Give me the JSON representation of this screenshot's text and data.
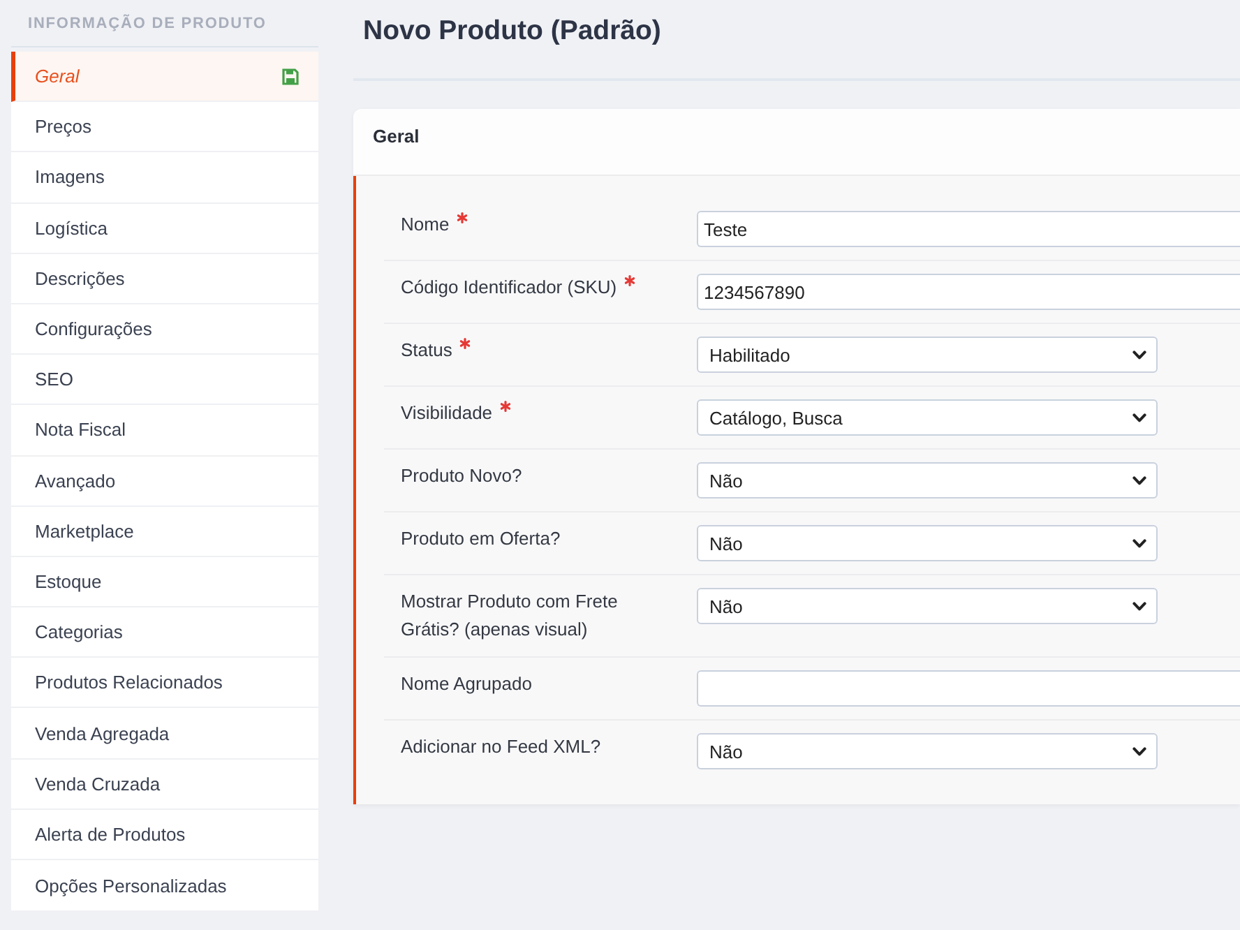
{
  "sidebar": {
    "heading": "INFORMAÇÃO DE PRODUTO",
    "items": [
      {
        "label": "Geral",
        "selected": true
      },
      {
        "label": "Preços",
        "selected": false
      },
      {
        "label": "Imagens",
        "selected": false
      },
      {
        "label": "Logística",
        "selected": false
      },
      {
        "label": "Descrições",
        "selected": false
      },
      {
        "label": "Configurações",
        "selected": false
      },
      {
        "label": "SEO",
        "selected": false
      },
      {
        "label": "Nota Fiscal",
        "selected": false
      },
      {
        "label": "Avançado",
        "selected": false
      },
      {
        "label": "Marketplace",
        "selected": false
      },
      {
        "label": "Estoque",
        "selected": false
      },
      {
        "label": "Categorias",
        "selected": false
      },
      {
        "label": "Produtos Relacionados",
        "selected": false
      },
      {
        "label": "Venda Agregada",
        "selected": false
      },
      {
        "label": "Venda Cruzada",
        "selected": false
      },
      {
        "label": "Alerta de Produtos",
        "selected": false
      },
      {
        "label": "Opções Personalizadas",
        "selected": false
      }
    ]
  },
  "page": {
    "title": "Novo Produto (Padrão)"
  },
  "card": {
    "title": "Geral",
    "fields": [
      {
        "kind": "text",
        "label": "Nome",
        "required": true,
        "value": "Teste"
      },
      {
        "kind": "text",
        "label": "Código Identificador (SKU)",
        "required": true,
        "value": "1234567890"
      },
      {
        "kind": "select",
        "label": "Status",
        "required": true,
        "value": "Habilitado"
      },
      {
        "kind": "select",
        "label": "Visibilidade",
        "required": true,
        "value": "Catálogo, Busca"
      },
      {
        "kind": "select",
        "label": "Produto Novo?",
        "required": false,
        "value": "Não"
      },
      {
        "kind": "select",
        "label": "Produto em Oferta?",
        "required": false,
        "value": "Não"
      },
      {
        "kind": "select",
        "label": "Mostrar Produto com Frete Grátis? (apenas visual)",
        "required": false,
        "value": "Não"
      },
      {
        "kind": "text",
        "label": "Nome Agrupado",
        "required": false
      },
      {
        "kind": "select",
        "label": "Adicionar no Feed XML?",
        "required": false,
        "value": "Não"
      }
    ]
  }
}
